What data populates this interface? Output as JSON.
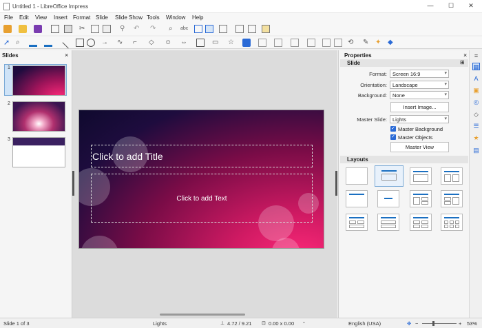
{
  "window": {
    "title": "Untitled 1 - LibreOffice Impress",
    "minimize": "—",
    "maximize": "☐",
    "close": "✕"
  },
  "menu": [
    "File",
    "Edit",
    "View",
    "Insert",
    "Format",
    "Slide",
    "Slide Show",
    "Tools",
    "Window",
    "Help"
  ],
  "slides_panel": {
    "title": "Slides",
    "close": "×",
    "numbers": [
      "1",
      "2",
      "3"
    ]
  },
  "slide": {
    "title_placeholder": "Click to add Title",
    "text_placeholder": "Click to add Text"
  },
  "properties": {
    "title": "Properties",
    "section_slide": "Slide",
    "format_label": "Format:",
    "format_value": "Screen 16:9",
    "orientation_label": "Orientation:",
    "orientation_value": "Landscape",
    "background_label": "Background:",
    "background_value": "None",
    "insert_image": "Insert Image...",
    "master_label": "Master Slide:",
    "master_value": "Lights",
    "master_background": "Master Background",
    "master_objects": "Master Objects",
    "master_view": "Master View",
    "section_layouts": "Layouts"
  },
  "status": {
    "slide": "Slide 1 of 3",
    "master": "Lights",
    "position": "4.72 / 9.21",
    "size": "0.00 x 0.00",
    "language": "English (USA)",
    "zoom": "53%"
  },
  "colors": {
    "accent": "#1a6fc1",
    "selection": "#cfe3f7"
  }
}
